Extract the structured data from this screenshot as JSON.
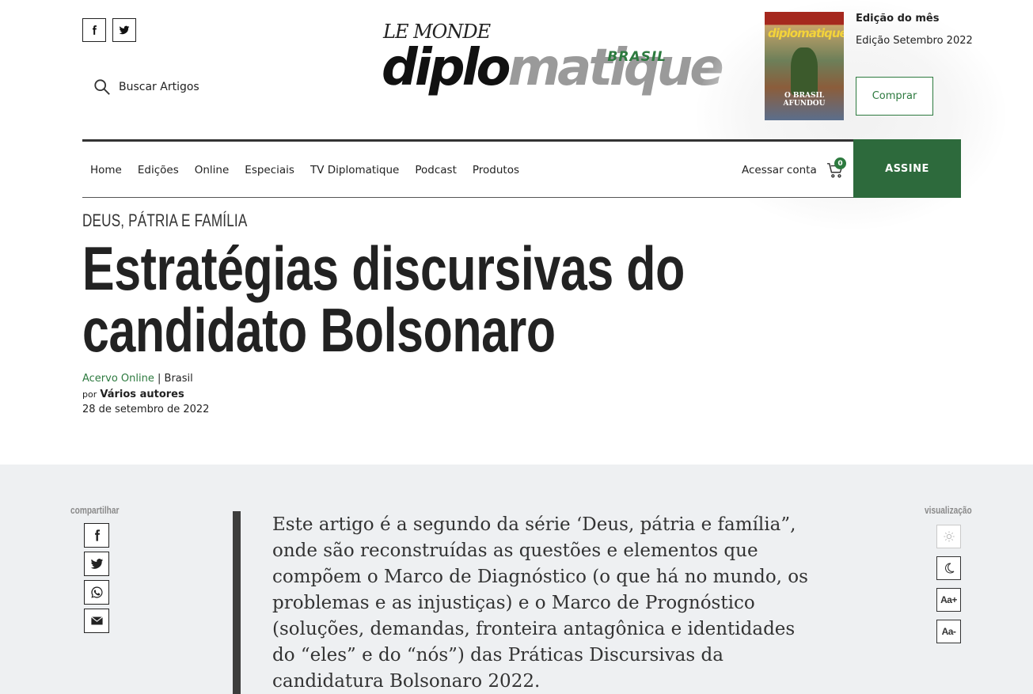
{
  "social_top": {
    "facebook_icon": "facebook-icon",
    "twitter_icon": "twitter-icon"
  },
  "search": {
    "label": "Buscar Artigos"
  },
  "logo": {
    "le_monde": "LE MONDE",
    "diplo_dark": "diplo",
    "diplo_light": "matique",
    "brasil": "BRASIL"
  },
  "edition": {
    "label": "Edição do mês",
    "name": "Edição Setembro 2022",
    "buy_label": "Comprar",
    "cover": {
      "title": "diplomatique",
      "headline": "O BRASIL AFUNDOU"
    }
  },
  "nav": {
    "items": [
      "Home",
      "Edições",
      "Online",
      "Especiais",
      "TV Diplomatique",
      "Podcast",
      "Produtos"
    ],
    "account": "Acessar conta",
    "cart_count": "0",
    "subscribe": "ASSINE"
  },
  "article": {
    "kicker": "DEUS, PÁTRIA E FAMÍLIA",
    "title": "Estratégias discursivas do candidato Bolsonaro",
    "section": "Acervo Online",
    "separator": "|",
    "region": "Brasil",
    "by": "por",
    "authors": "Vários autores",
    "date": "28 de setembro de 2022",
    "lead": "Este artigo é a segundo da série ‘Deus, pátria e família”, onde são reconstruídas as questões e elementos que compõem o Marco de Diagnóstico (o que há no mundo, os problemas e as injustiças) e o Marco de Prognóstico (soluções, demandas, fronteira antagônica e identidades do “eles” e do “nós”) das Práticas Discursivas da candidatura Bolsonaro 2022."
  },
  "share": {
    "label": "compartilhar",
    "icons": [
      "facebook-icon",
      "twitter-icon",
      "whatsapp-icon",
      "email-icon"
    ]
  },
  "display": {
    "label": "visualização",
    "increase": "Aa+",
    "decrease": "Aa-"
  },
  "colors": {
    "accent": "#2d7a3f",
    "subscribe_bg": "#2d6a3c",
    "body_bg": "#eef0f2"
  }
}
